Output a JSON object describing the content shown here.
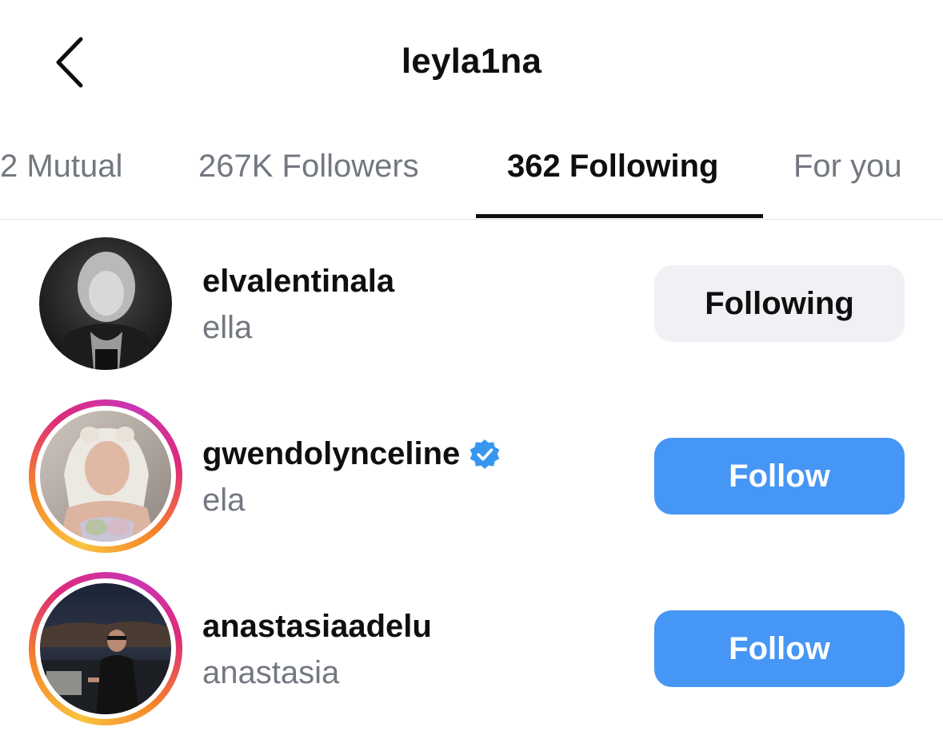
{
  "header": {
    "title": "leyla1na",
    "back_icon": "chevron-left-icon"
  },
  "tabs": [
    {
      "label": "2 Mutual",
      "active": false
    },
    {
      "label": "267K Followers",
      "active": false
    },
    {
      "label": "362 Following",
      "active": true
    },
    {
      "label": "For you",
      "active": false
    }
  ],
  "users": [
    {
      "username": "elvalentinala",
      "fullname": "ella",
      "verified": false,
      "has_story": false,
      "button_label": "Following",
      "button_state": "following"
    },
    {
      "username": "gwendolynceline",
      "fullname": "ela",
      "verified": true,
      "has_story": true,
      "button_label": "Follow",
      "button_state": "follow"
    },
    {
      "username": "anastasiaadelu",
      "fullname": "anastasia",
      "verified": false,
      "has_story": true,
      "button_label": "Follow",
      "button_state": "follow"
    }
  ],
  "colors": {
    "follow_button": "#4696f5",
    "following_button": "#eff1f4",
    "verified_badge": "#3797f0",
    "secondary_text": "#737880"
  }
}
